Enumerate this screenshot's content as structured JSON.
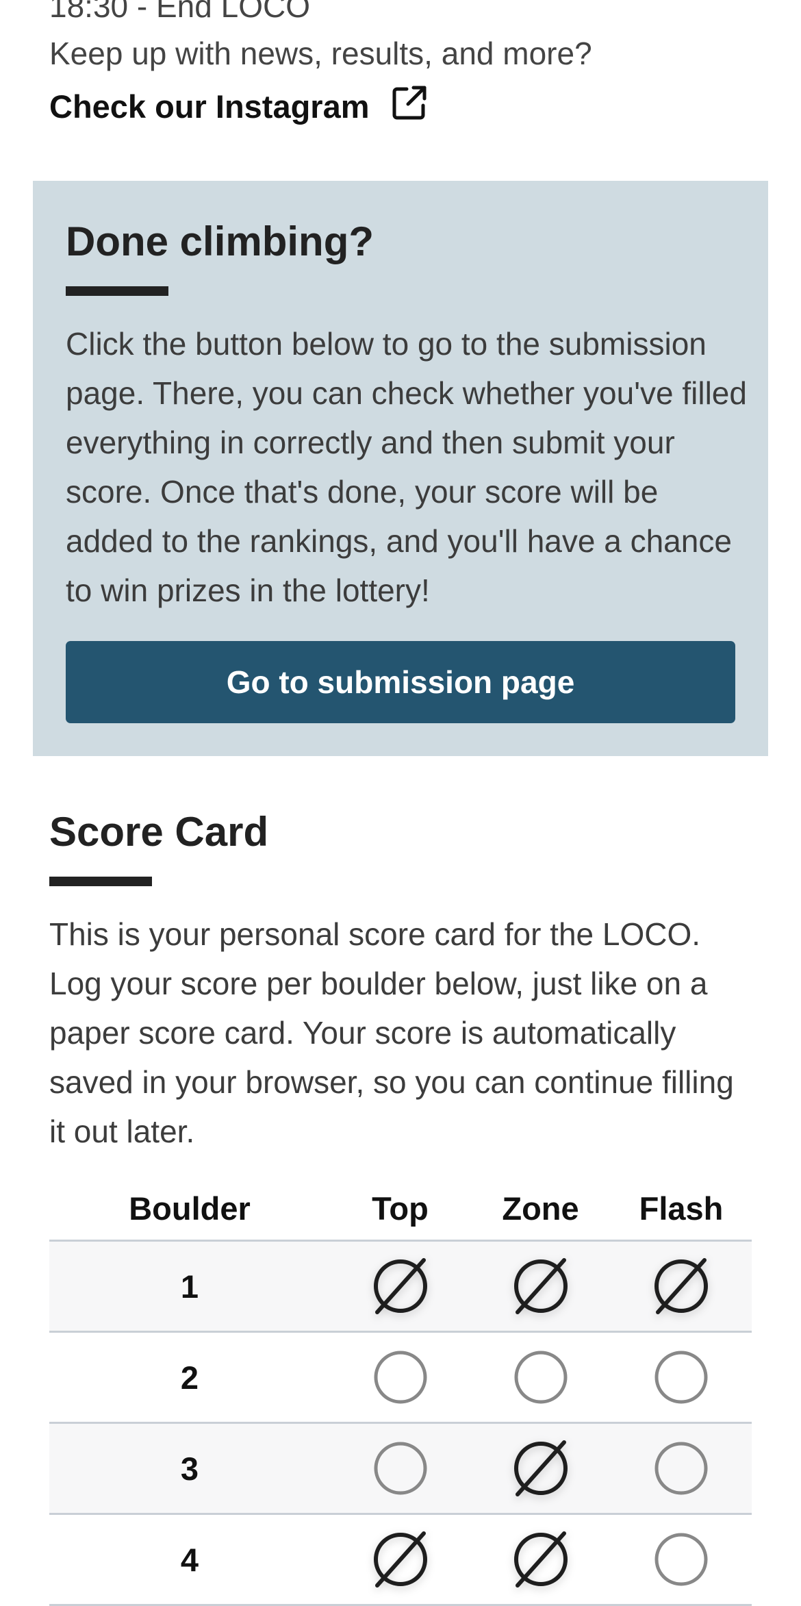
{
  "top_info": {
    "end_time": "18:30 - End LOCO",
    "news_line": "Keep up with news, results, and more?",
    "instagram_link": "Check our Instagram"
  },
  "done_panel": {
    "title": "Done climbing?",
    "text": "Click the button below to go to the submission page. There, you can check whether you've filled everything in correctly and then submit your score. Once that's done, your score will be added to the rankings, and you'll have a chance to win prizes in the lottery!",
    "button_label": "Go to submission page"
  },
  "score_card": {
    "title": "Score Card",
    "text": "This is your personal score card for the LOCO. Log your score per boulder below, just like on a paper score card. Your score is automatically saved in your browser, so you can continue filling it out later.",
    "columns": [
      "Boulder",
      "Top",
      "Zone",
      "Flash"
    ],
    "rows": [
      {
        "boulder": "1",
        "top": true,
        "zone": true,
        "flash": true
      },
      {
        "boulder": "2",
        "top": false,
        "zone": false,
        "flash": false
      },
      {
        "boulder": "3",
        "top": false,
        "zone": true,
        "flash": false
      },
      {
        "boulder": "4",
        "top": true,
        "zone": true,
        "flash": false
      }
    ]
  },
  "icons": {
    "external_link": "external-link-icon",
    "checked": "slashed-circle-icon",
    "unchecked": "empty-circle-icon"
  },
  "colors": {
    "panel_bg": "#cfdbe1",
    "button_bg": "#245570",
    "button_text": "#ffffff",
    "checked_stroke": "#1e1e1e",
    "unchecked_stroke": "#888888"
  }
}
